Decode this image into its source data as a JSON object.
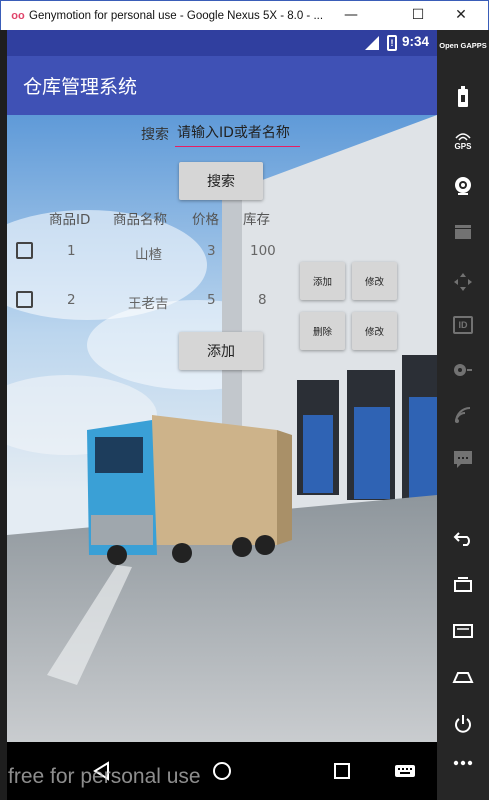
{
  "window": {
    "title": "Genymotion for personal use - Google Nexus 5X - 8.0 - ...",
    "logo_text": "oo",
    "min_glyph": "—",
    "max_glyph": "☐",
    "close_glyph": "✕"
  },
  "statusbar": {
    "time": "9:34",
    "battery_glyph": "!"
  },
  "app": {
    "title": "仓库管理系统"
  },
  "search": {
    "label": "搜索",
    "placeholder": "请输入ID或者名称",
    "value": ""
  },
  "buttons": {
    "search": "搜索",
    "add_main": "添加"
  },
  "table": {
    "headers": [
      "商品ID",
      "商品名称",
      "价格",
      "库存"
    ],
    "rows": [
      {
        "id": "1",
        "name": "山楂",
        "price": "3",
        "stock": "100",
        "action1": "添加",
        "action2": "修改"
      },
      {
        "id": "2",
        "name": "王老吉",
        "price": "5",
        "stock": "8",
        "action1": "删除",
        "action2": "修改"
      }
    ]
  },
  "sidepanel": {
    "opengapps": "Open GAPPS",
    "gps": "GPS",
    "id": "ID"
  },
  "nav": {
    "watermark": "free for personal use"
  },
  "colors": {
    "statusbar": "#303f9f",
    "appbar": "#3f51b5",
    "input_underline": "#e91e63"
  }
}
